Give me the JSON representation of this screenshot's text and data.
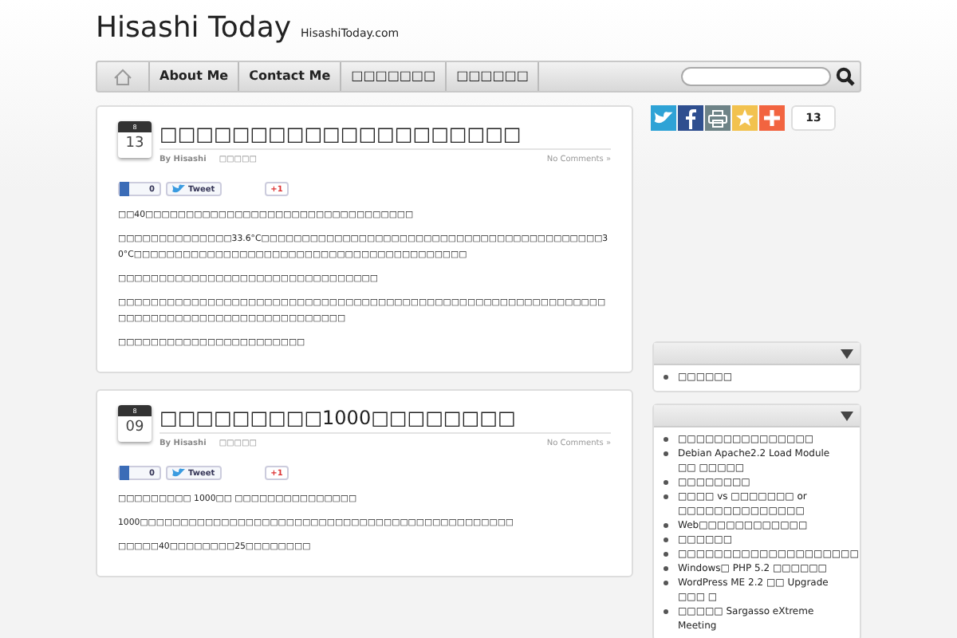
{
  "site": {
    "title": "Hisashi Today",
    "tagline": "HisashiToday.com"
  },
  "nav": {
    "items": [
      {
        "label": "About Me",
        "selected": false
      },
      {
        "label": "Contact Me",
        "selected": false
      },
      {
        "label": "□□□□□□□",
        "selected": false
      },
      {
        "label": "□□□□□□",
        "selected": false
      }
    ]
  },
  "share": {
    "count": "13"
  },
  "posts": [
    {
      "month": "8",
      "day": "13",
      "title": "□□□□□□□□□□□□□□□□□□□□",
      "author": "By Hisashi",
      "category": "□□□□□",
      "comments": "No Comments »",
      "likes": "0",
      "tweet": "Tweet",
      "plus": "+1",
      "paragraphs": [
        "□□40□□□□□□□□□□□□□□□□□□□□□□□□□□□□□□□□□",
        "□□□□□□□□□□□□□□33.6°C□□□□□□□□□□□□□□□□□□□□□□□□□□□□□□□□□□□□□□□□□□30°C□□□□□□□□□□□□□□□□□□□□□□□□□□□□□□□□□□□□□□□□□",
        "□□□□□□□□□□□□□□□□□□□□□□□□□□□□□□□□",
        "□□□□□□□□□□□□□□□□□□□□□□□□□□□□□□□□□□□□□□□□□□□□□□□□□□□□□□□□□□□□□□□□□□□□□□□□□□□□□□□□□□□□□□□□",
        "□□□□□□□□□□□□□□□□□□□□□□□"
      ]
    },
    {
      "month": "8",
      "day": "09",
      "title": "□□□□□□□□□1000□□□□□□□□",
      "author": "By Hisashi",
      "category": "□□□□□",
      "comments": "No Comments »",
      "likes": "0",
      "tweet": "Tweet",
      "plus": "+1",
      "paragraphs": [
        "□□□□□□□□□ 1000□□ □□□□□□□□□□□□□□□",
        "1000□□□□□□□□□□□□□□□□□□□□□□□□□□□□□□□□□□□□□□□□□□□□□□",
        "□□□□□40□□□□□□□□25□□□□□□□□"
      ]
    }
  ],
  "widgets": [
    {
      "items": [
        "□□□□□□"
      ]
    },
    {
      "items": [
        "□□□□□□□□□□□□□□□",
        "Debian Apache2.2 Load Module □□ □□□□□",
        "□□□□□□□□",
        "□□□□ vs □□□□□□□ or □□□□□□□□□□□□□□",
        "Web□□□□□□□□□□□□",
        "□□□□□□",
        "□□□□□□□□□□□□□□□□□□□□",
        "Windows□ PHP 5.2 □□□□□□",
        "WordPress ME 2.2 □□ Upgrade □□□ □",
        "□□□□□ Sargasso eXtreme Meeting"
      ]
    }
  ]
}
